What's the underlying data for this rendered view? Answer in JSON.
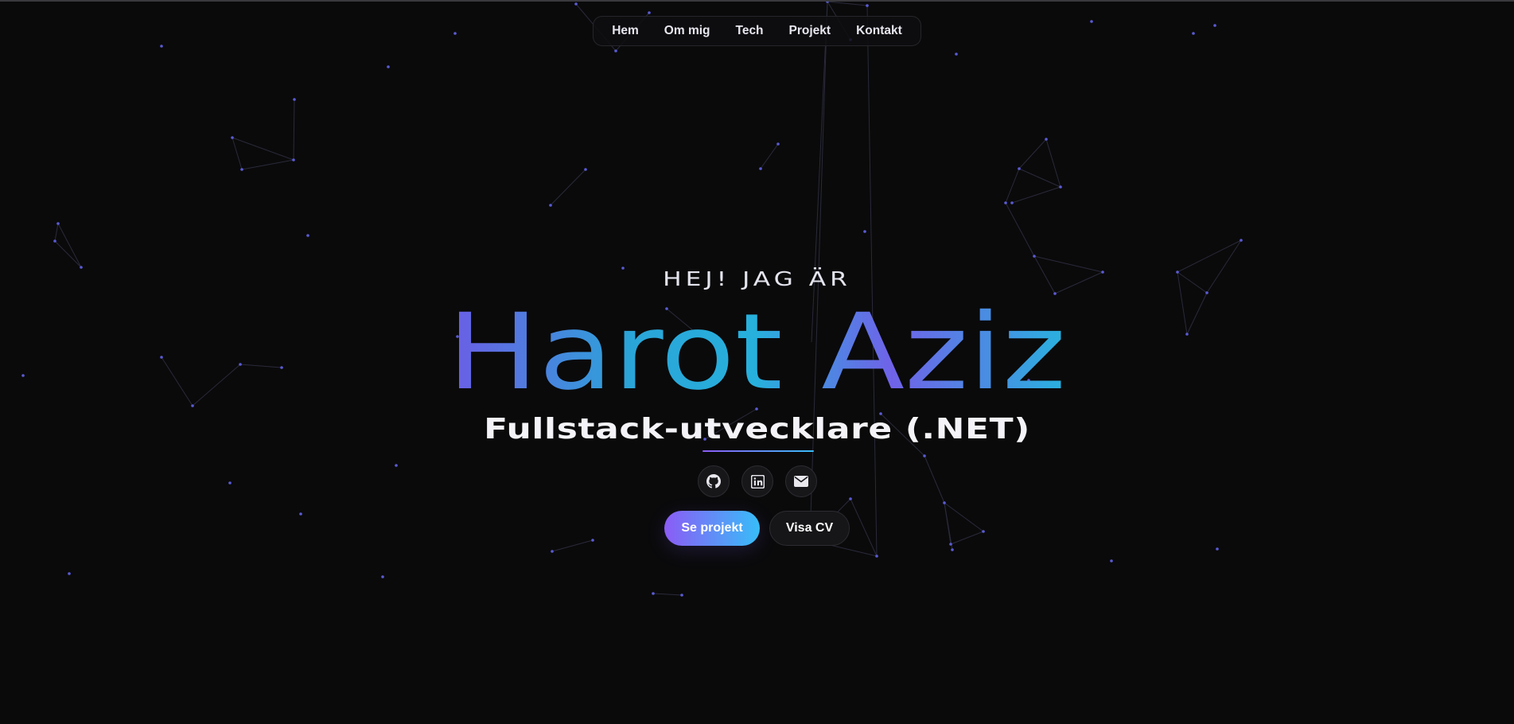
{
  "nav": {
    "items": [
      {
        "label": "Hem"
      },
      {
        "label": "Om mig"
      },
      {
        "label": "Tech"
      },
      {
        "label": "Projekt"
      },
      {
        "label": "Kontakt"
      }
    ]
  },
  "hero": {
    "greeting": "HEJ! JAG ÄR",
    "name": "Harot Aziz",
    "role": "Fullstack-utvecklare (.NET)"
  },
  "socials": [
    {
      "icon": "github-icon"
    },
    {
      "icon": "linkedin-icon"
    },
    {
      "icon": "mail-icon"
    }
  ],
  "actions": {
    "primary_label": "Se projekt",
    "secondary_label": "Visa CV"
  },
  "colors": {
    "background": "#0a0a0b",
    "accent_start": "#8b5cf6",
    "accent_end": "#38bdf8",
    "particle": "#5b5bd6"
  }
}
